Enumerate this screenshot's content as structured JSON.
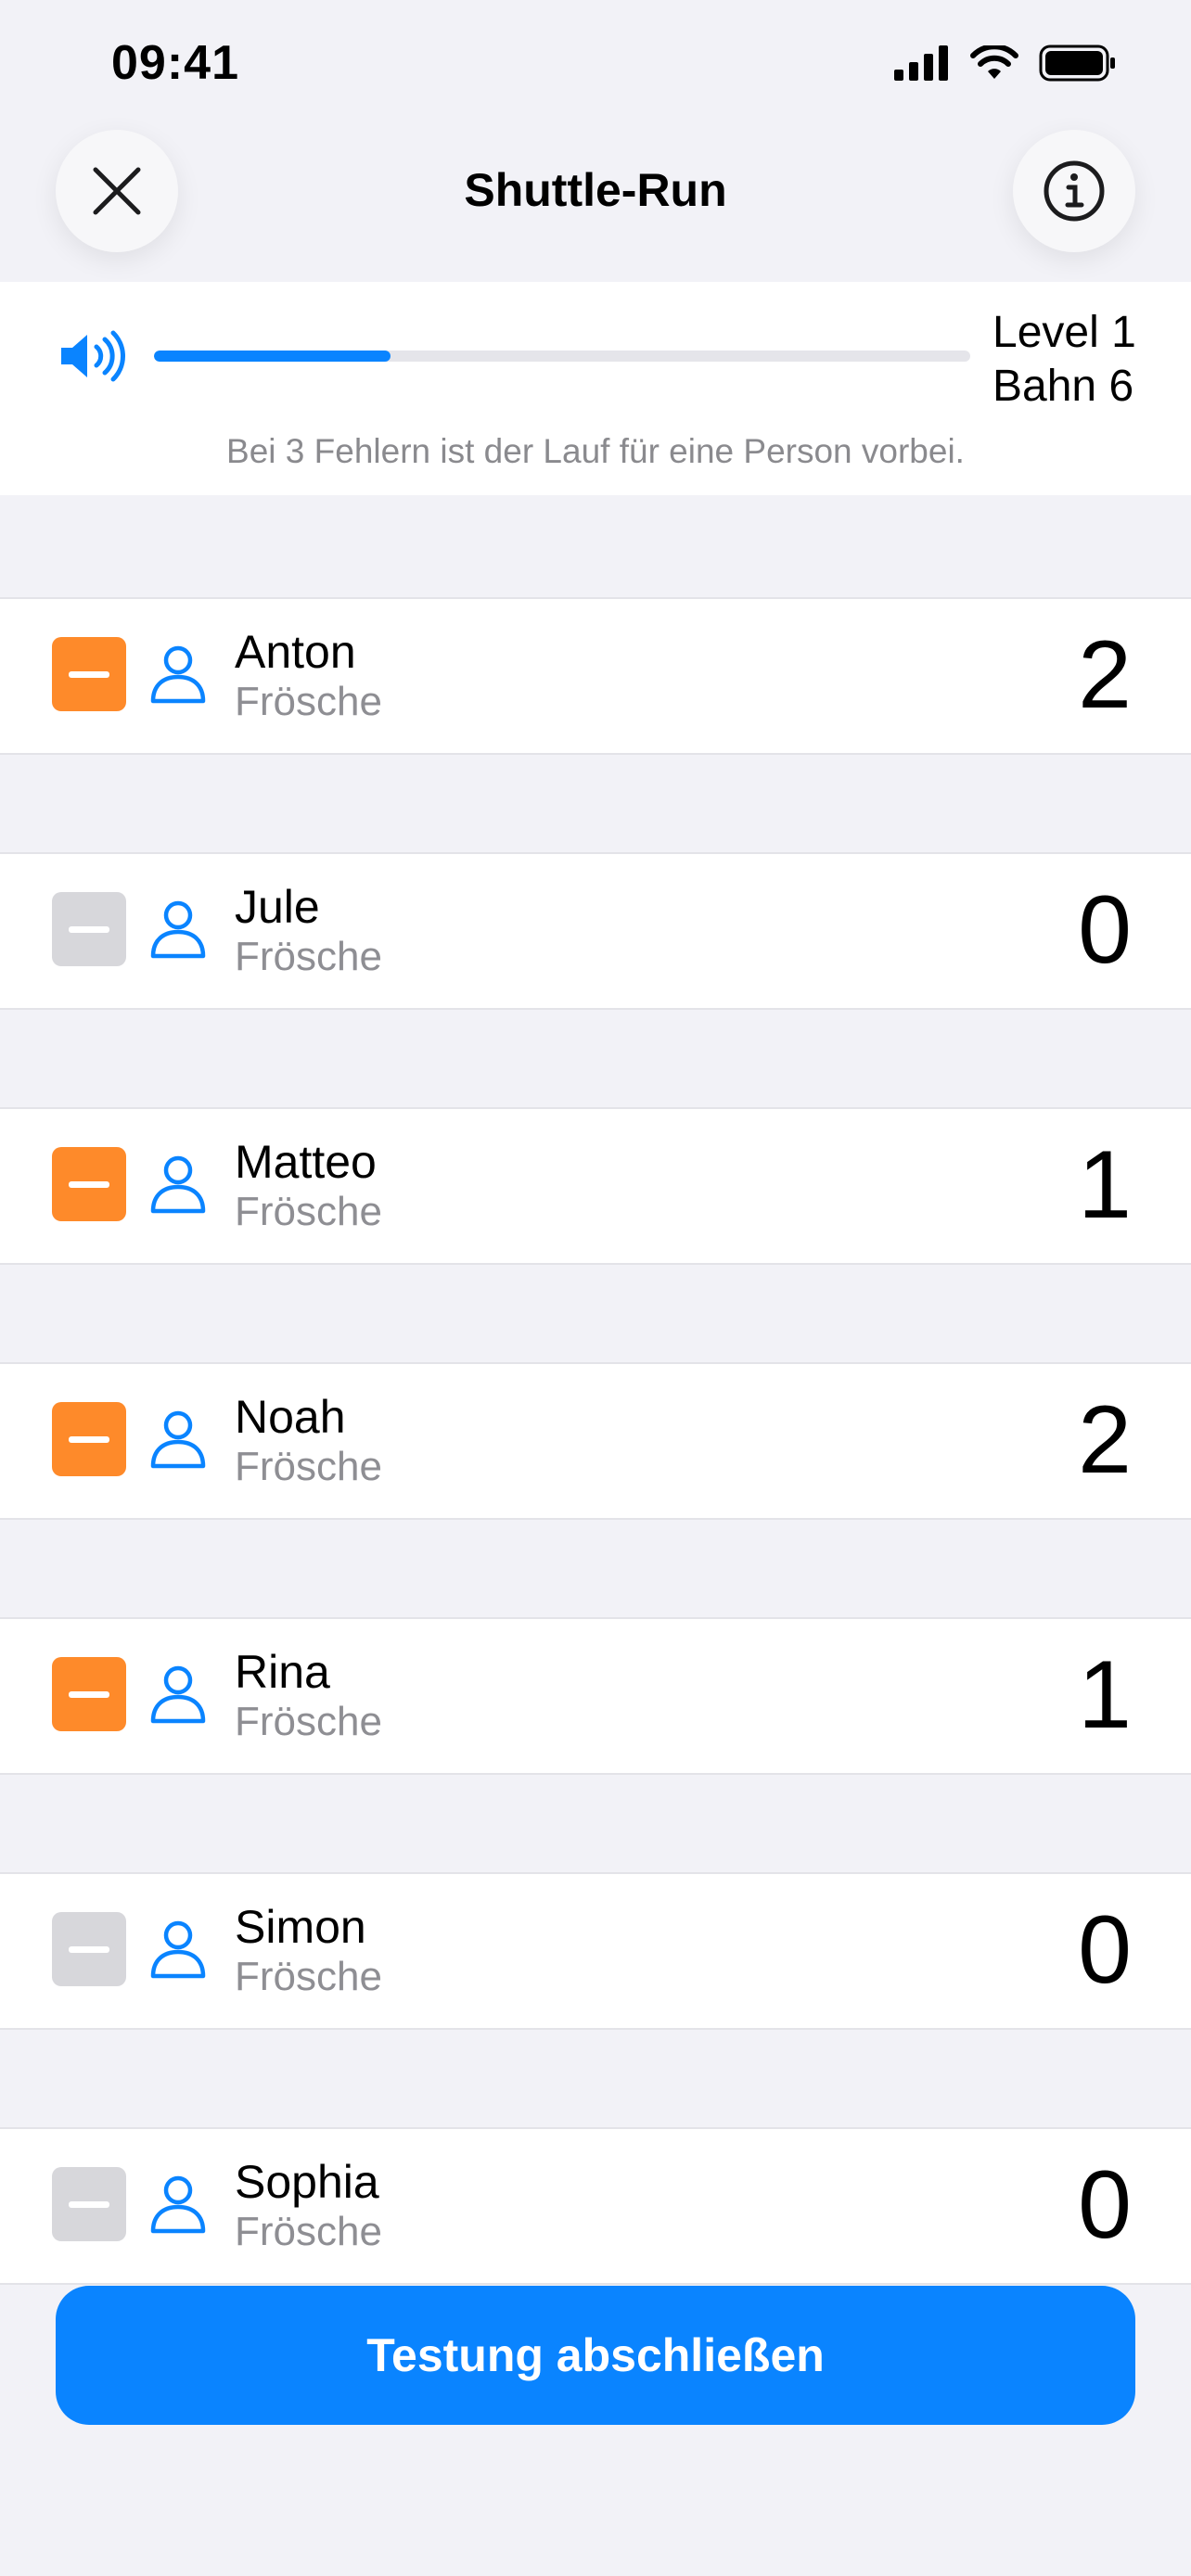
{
  "status_bar": {
    "time": "09:41"
  },
  "nav": {
    "title": "Shuttle-Run"
  },
  "audio": {
    "progress": 0.29,
    "level": "Level 1",
    "lane": "Bahn 6"
  },
  "hint": "Bei 3 Fehlern ist der Lauf für eine Person vorbei.",
  "participants": [
    {
      "name": "Anton",
      "group": "Frösche",
      "errors": "2"
    },
    {
      "name": "Jule",
      "group": "Frösche",
      "errors": "0"
    },
    {
      "name": "Matteo",
      "group": "Frösche",
      "errors": "1"
    },
    {
      "name": "Noah",
      "group": "Frösche",
      "errors": "2"
    },
    {
      "name": "Rina",
      "group": "Frösche",
      "errors": "1"
    },
    {
      "name": "Simon",
      "group": "Frösche",
      "errors": "0"
    },
    {
      "name": "Sophia",
      "group": "Frösche",
      "errors": "0"
    }
  ],
  "footer": {
    "button_label": "Testung abschließen"
  },
  "colors": {
    "accent": "#0A84FF",
    "minus_active": "#FE8A2A",
    "minus_inactive": "#D7D7DB"
  }
}
